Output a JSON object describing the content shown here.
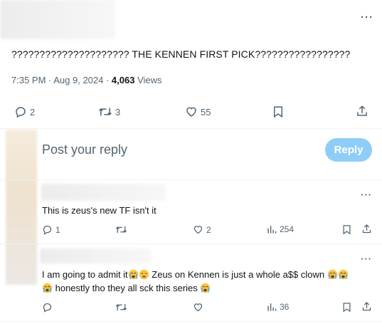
{
  "tweet": {
    "text": "????????????????????? THE KENNEN FIRST PICK?????????????????",
    "time": "7:35 PM · Aug 9, 2024 · ",
    "views_count": "4,063",
    "views_label": "Views",
    "replies": "2",
    "reposts": "3",
    "likes": "55"
  },
  "composer": {
    "placeholder": "Post your reply",
    "button": "Reply"
  },
  "replies": [
    {
      "text": "This is zeus's new TF isn't it",
      "replies": "1",
      "likes": "2",
      "views": "254"
    },
    {
      "text_line1_a": "I am going to admit it",
      "text_line1_b": " Zeus on Kennen is just a whole a$$ clown ",
      "text_line2": " honestly tho they all sck this series ",
      "views": "36"
    }
  ],
  "colors": {
    "accent_disabled": "#8ecdf7",
    "muted": "#536471",
    "divider": "#eff3f4"
  },
  "icons": [
    "more-icon",
    "reply-icon",
    "repost-icon",
    "like-icon",
    "bookmark-icon",
    "share-icon",
    "views-icon",
    "crying-emoji",
    "weary-emoji"
  ]
}
